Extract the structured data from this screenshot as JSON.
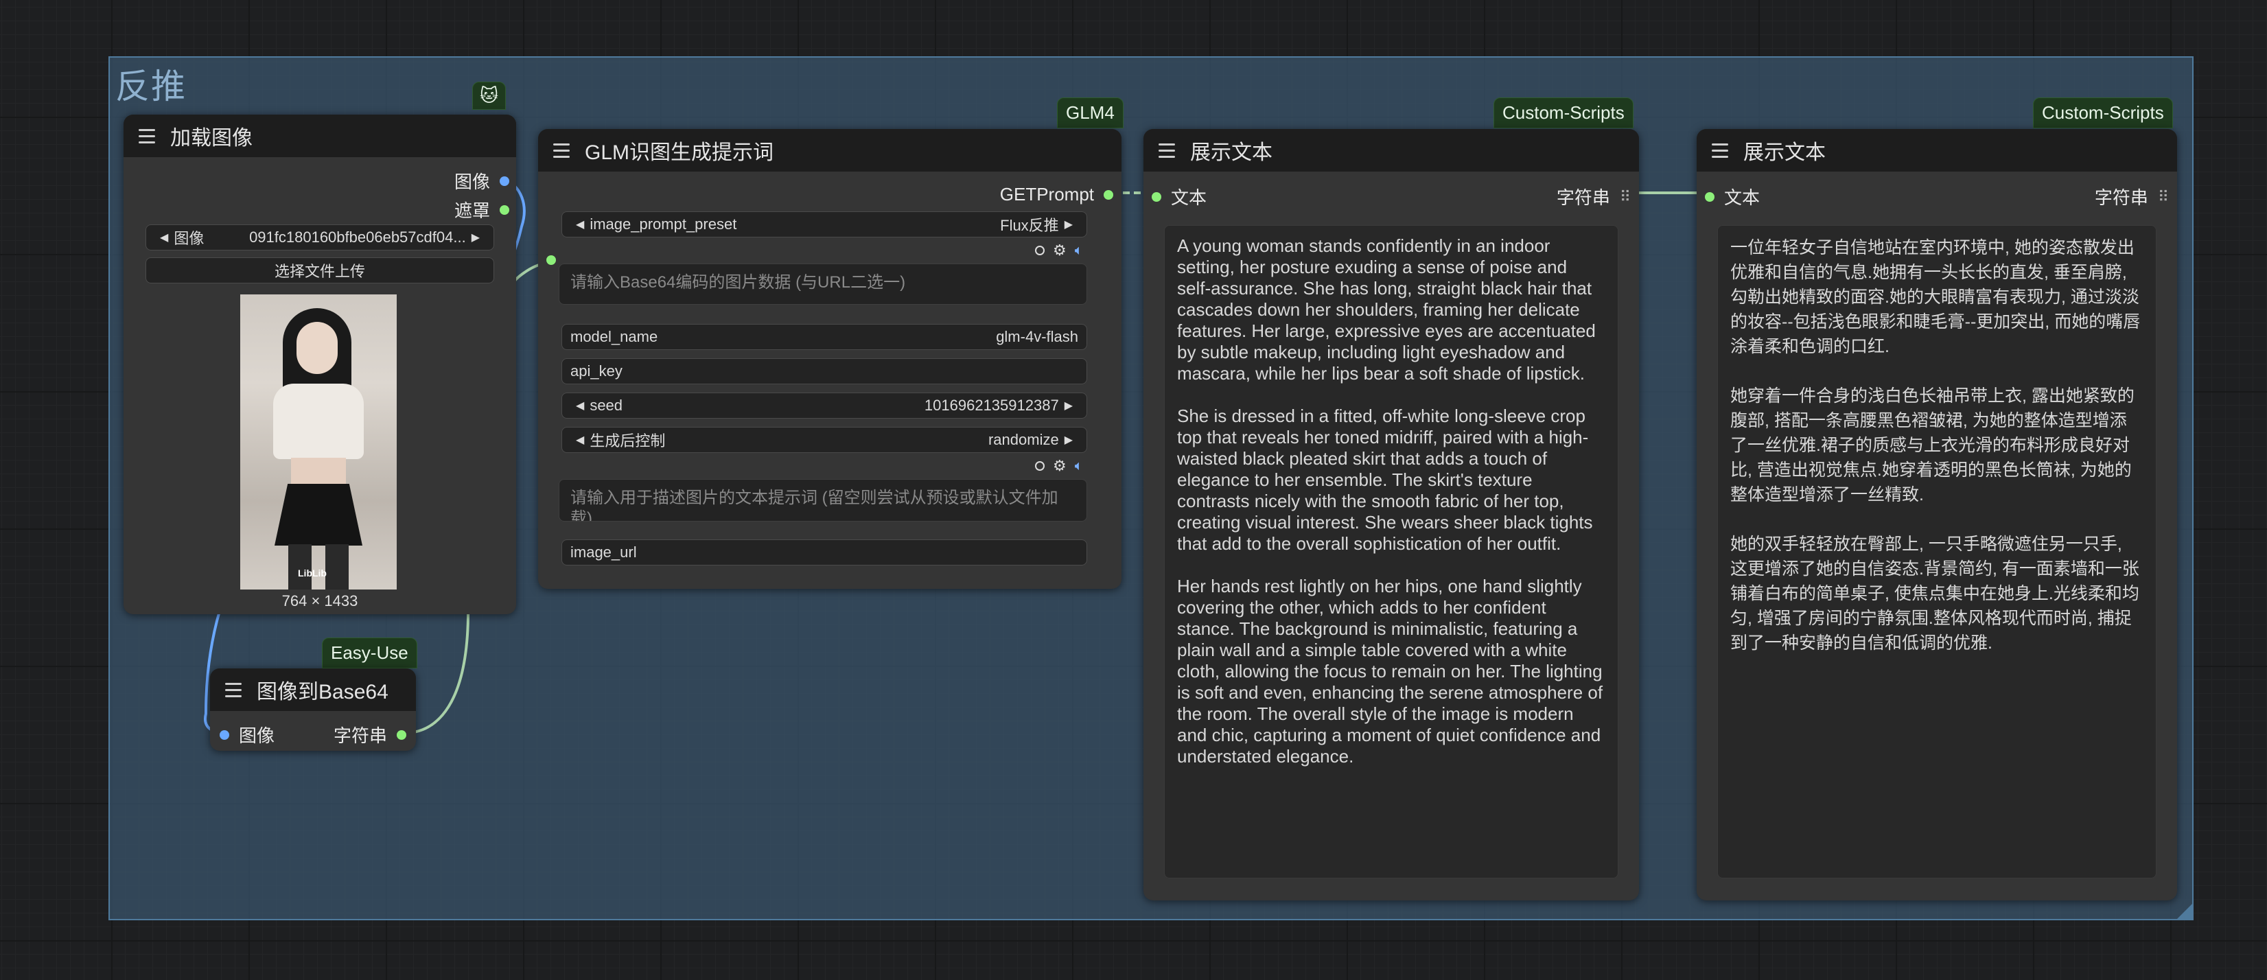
{
  "group": {
    "title": "反推"
  },
  "load_image": {
    "title": "加载图像",
    "badge_icon": "🐱",
    "outputs": [
      "图像",
      "遮罩"
    ],
    "image_widget_label": "图像",
    "image_widget_value": "091fc180160bfbe06eb57cdf04...",
    "upload_button": "选择文件上传",
    "preview_caption": "764 × 1433",
    "watermark": "LibLib"
  },
  "to_base64": {
    "badge": "Easy-Use",
    "title": "图像到Base64",
    "input": "图像",
    "output": "字符串"
  },
  "glm": {
    "badge": "GLM4",
    "title": "GLM识图生成提示词",
    "output": "GETPrompt",
    "preset_label": "image_prompt_preset",
    "preset_value": "Flux反推",
    "base64_placeholder": "请输入Base64编码的图片数据 (与URL二选一)",
    "model_label": "model_name",
    "model_value": "glm-4v-flash",
    "api_key_label": "api_key",
    "seed_label": "seed",
    "seed_value": "1016962135912387",
    "control_label": "生成后控制",
    "control_value": "randomize",
    "prompt_placeholder": "请输入用于描述图片的文本提示词 (留空则尝试从预设或默认文件加载)",
    "image_url_label": "image_url"
  },
  "show_en": {
    "badge": "Custom-Scripts",
    "title": "展示文本",
    "input": "文本",
    "output": "字符串",
    "text": "A young woman stands confidently in an indoor setting, her posture exuding a sense of poise and self-assurance. She has long, straight black hair that cascades down her shoulders, framing her delicate features. Her large, expressive eyes are accentuated by subtle makeup, including light eyeshadow and mascara, while her lips bear a soft shade of lipstick.\n\nShe is dressed in a fitted, off-white long-sleeve crop top that reveals her toned midriff, paired with a high-waisted black pleated skirt that adds a touch of elegance to her ensemble. The skirt's texture contrasts nicely with the smooth fabric of her top, creating visual interest. She wears sheer black tights that add to the overall sophistication of her outfit.\n\nHer hands rest lightly on her hips, one hand slightly covering the other, which adds to her confident stance. The background is minimalistic, featuring a plain wall and a simple table covered with a white cloth, allowing the focus to remain on her. The lighting is soft and even, enhancing the serene atmosphere of the room. The overall style of the image is modern and chic, capturing a moment of quiet confidence and understated elegance."
  },
  "show_zh": {
    "badge": "Custom-Scripts",
    "title": "展示文本",
    "input": "文本",
    "output": "字符串",
    "text": "一位年轻女子自信地站在室内环境中, 她的姿态散发出优雅和自信的气息.她拥有一头长长的直发, 垂至肩膀, 勾勒出她精致的面容.她的大眼睛富有表现力, 通过淡淡的妆容--包括浅色眼影和睫毛膏--更加突出, 而她的嘴唇涂着柔和色调的口红.\n\n她穿着一件合身的浅白色长袖吊带上衣, 露出她紧致的腹部, 搭配一条高腰黑色褶皱裙, 为她的整体造型增添了一丝优雅.裙子的质感与上衣光滑的布料形成良好对比, 营造出视觉焦点.她穿着透明的黑色长筒袜, 为她的整体造型增添了一丝精致.\n\n她的双手轻轻放在臀部上, 一只手略微遮住另一只手, 这更增添了她的自信姿态.背景简约, 有一面素墙和一张铺着白布的简单桌子, 使焦点集中在她身上.光线柔和均匀, 增强了房间的宁静氛围.整体风格现代而时尚, 捕捉到了一种安静的自信和低调的优雅."
  },
  "colors": {
    "image_link": "#6aa8ff",
    "string_link": "#a8d0a8",
    "badge_bg": "#1e3a1e"
  }
}
